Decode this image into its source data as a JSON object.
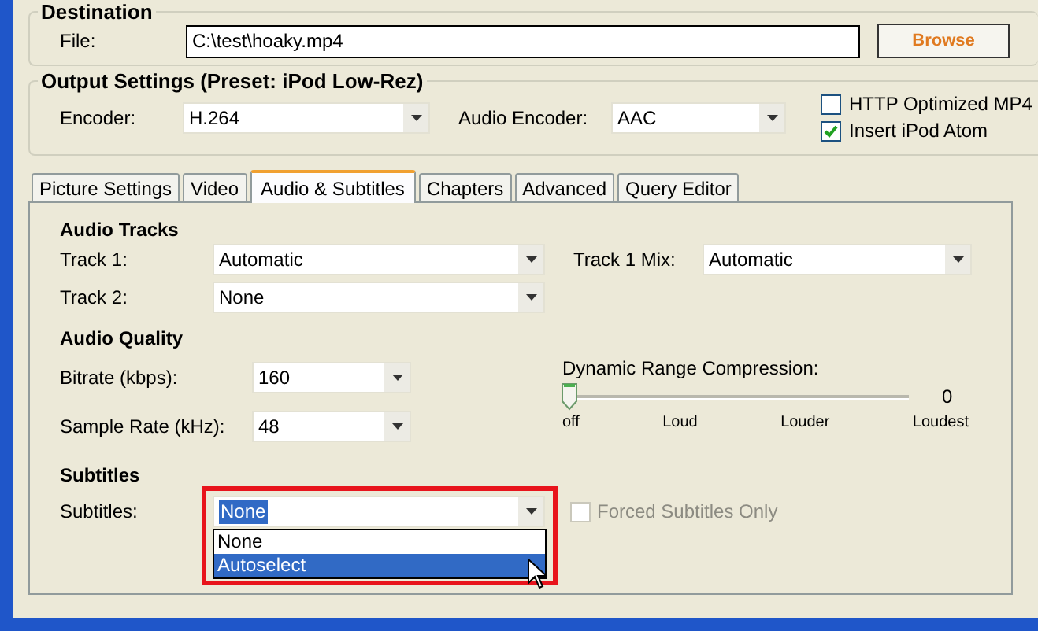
{
  "destination": {
    "title": "Destination",
    "file_label": "File:",
    "file_value": "C:\\test\\hoaky.mp4",
    "browse_button": "Browse"
  },
  "output_settings": {
    "title": "Output Settings (Preset: iPod Low-Rez)",
    "encoder_label": "Encoder:",
    "encoder": "H.264",
    "audio_encoder_label": "Audio Encoder:",
    "audio_encoder": "AAC",
    "options": [
      {
        "label": "HTTP Optimized MP4",
        "checked": false
      },
      {
        "label": "Insert iPod Atom",
        "checked": true
      }
    ]
  },
  "tabs": [
    {
      "label": "Picture Settings",
      "selected": false
    },
    {
      "label": "Video",
      "selected": false
    },
    {
      "label": "Audio & Subtitles",
      "selected": true
    },
    {
      "label": "Chapters",
      "selected": false
    },
    {
      "label": "Advanced",
      "selected": false
    },
    {
      "label": "Query Editor",
      "selected": false
    }
  ],
  "audio_tracks": {
    "title": "Audio Tracks",
    "track1_label": "Track 1:",
    "track1": "Automatic",
    "mix_label": "Track 1 Mix:",
    "mix": "Automatic",
    "track2_label": "Track 2:",
    "track2": "None"
  },
  "audio_quality": {
    "title": "Audio Quality",
    "bitrate_label": "Bitrate (kbps):",
    "bitrate": "160",
    "sample_rate_label": "Sample Rate (kHz):",
    "sample_rate": "48",
    "drc": {
      "label": "Dynamic Range Compression:",
      "level": 0,
      "reading": "0",
      "ticks": [
        "off",
        "Loud",
        "Louder",
        "Loudest"
      ]
    }
  },
  "subtitles": {
    "title": "Subtitles",
    "label": "Subtitles:",
    "value": "None",
    "forced": {
      "label": "Forced Subtitles Only",
      "checked": false,
      "disabled": true
    },
    "dropdown": {
      "expanded": true,
      "options": [
        {
          "label": "None",
          "selected": false
        },
        {
          "label": "Autoselect",
          "selected": true
        }
      ]
    }
  }
}
